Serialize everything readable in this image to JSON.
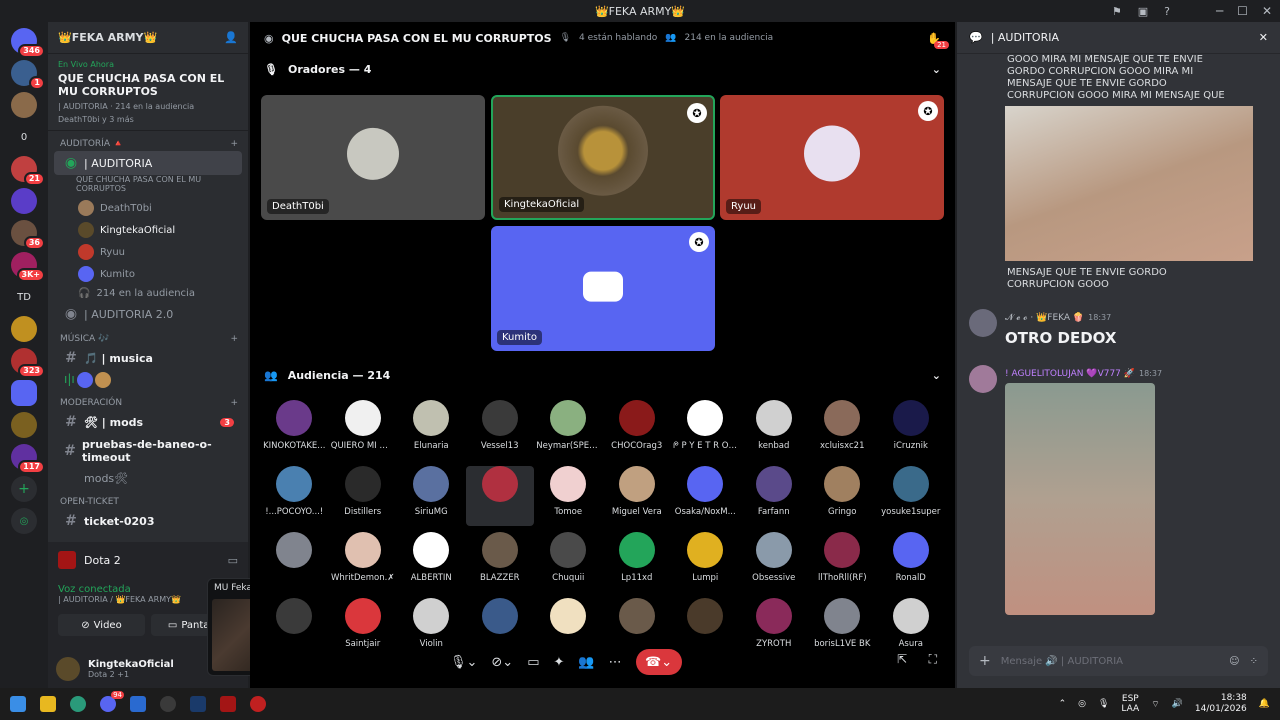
{
  "window": {
    "title": "👑FEKA ARMY👑"
  },
  "rail": {
    "badges": [
      "346",
      "1",
      "0",
      "21",
      "36",
      "3K+",
      "TD",
      "323",
      "117"
    ]
  },
  "guild": {
    "name": "👑FEKA ARMY👑",
    "live": {
      "tag": "En Vivo Ahora",
      "title": "QUE CHUCHA PASA CON EL MU CORRUPTOS",
      "meta1": "| AUDITORIA · 214 en la audiencia",
      "meta2": "DeathT0bi y 3 más"
    },
    "categories": {
      "auditoria": "AUDITORÍA 🔺",
      "musica": "MÚSICA 🎶",
      "moderacion": "MODERACIÓN",
      "ticket": "OPEN-TICKET"
    },
    "channels": {
      "auditoria_stage": "| AUDITORIA",
      "auditoria_sub": "QUE CHUCHA PASA CON EL MU CORRUPTOS",
      "audience": "214 en la audiencia",
      "auditoria2": "| AUDITORIA 2.0",
      "musica": "🎵 | musica",
      "mods": "🛠 | mods",
      "mods_badge": "3",
      "baneo": "pruebas-de-baneo-o-timeout",
      "mods_voice": "mods🛠",
      "ticket": "ticket-0203"
    },
    "members": [
      "DeathT0bi",
      "KingtekaOficial",
      "Ryuu",
      "Kumito"
    ]
  },
  "activity": {
    "game": "Dota 2"
  },
  "voice": {
    "status": "Voz conectada",
    "sub": "| AUDITORIA / 👑FEKA ARMY👑",
    "video": "Video",
    "screen": "Pantalla"
  },
  "user": {
    "name": "KingtekaOficial",
    "status": "Dota 2 +1"
  },
  "popup": {
    "title": "MU Feka | Seas..."
  },
  "stage": {
    "title": "QUE CHUCHA PASA CON EL MU CORRUPTOS",
    "speaking": "4 están hablando",
    "audience": "214 en la audiencia",
    "speakers_label": "Oradores — 4",
    "audience_label": "Audiencia — 214",
    "bell_badge": "21",
    "speakers": [
      "DeathT0bi",
      "KingtekaOficial",
      "Ryuu",
      "Kumito"
    ],
    "audience_names": [
      "KINOKOTAKE...",
      "QUIERO MI M...",
      "Elunaria",
      "Vessel13",
      "Neymar(SPEE...",
      "CHOCOrag3",
      "ᖘ P Y E T R Ô ◢",
      "kenbad",
      "xcluisxc21",
      "iCruznik",
      "!...POCOYO...!",
      "Distillers",
      "SiriuMG",
      "",
      "Tomoe",
      "Miguel Vera",
      "Osaka/NoxM...",
      "Farfann",
      "Gringo",
      "yosuke1super",
      "",
      "WhritDemon.✗",
      "ALBERTIN",
      "BLAZZER",
      "Chuquii",
      "Lp11xd",
      "Lumpi",
      "Obsessive",
      "llThoRll(RF)",
      "RonalD",
      "",
      "Saintjair",
      "Violin",
      "",
      "",
      "",
      "",
      "ZYROTH",
      "borisL1VE BK",
      "Asura"
    ]
  },
  "chat": {
    "title": "| AUDITORIA",
    "text1": "GOOO MIRA MI MENSAJE QUE TE ENVIE GORDO CORRUPCION GOOO MIRA MI MENSAJE QUE TE ENVIE GORDO CORRUPCION GOOO MIRA MI MENSAJE QUE TE ENVIE GORDO CORRUPCION",
    "text2": "MENSAJE QUE TE ENVIE GORDO CORRUPCION GOOO",
    "msg1_name": "𝓝 𝓮 𝓸 · 👑FEKA 🍿",
    "msg1_time": "18:37",
    "msg1_text": "OTRO DEDOX",
    "msg2_name": "! AGUELITOLUJAN 💜V777 🚀",
    "msg2_time": "18:37",
    "input_placeholder": "Mensaje 🔊 | AUDITORIA"
  },
  "taskbar": {
    "lang1": "ESP",
    "lang2": "LAA",
    "time": "18:38",
    "date": "14/01/2026",
    "discord_badge": "94"
  }
}
